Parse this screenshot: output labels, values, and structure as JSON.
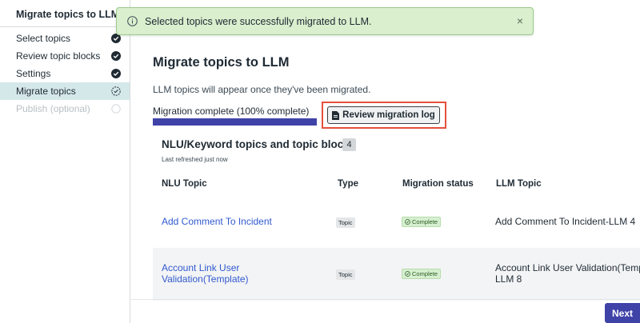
{
  "sidebar": {
    "title": "Migrate topics to LLM",
    "steps": [
      {
        "label": "Select topics"
      },
      {
        "label": "Review topic blocks"
      },
      {
        "label": "Settings"
      },
      {
        "label": "Migrate topics"
      },
      {
        "label": "Publish (optional)"
      }
    ]
  },
  "toast": {
    "message": "Selected topics were successfully migrated to LLM.",
    "close": "×"
  },
  "main": {
    "title": "Migrate topics to LLM",
    "subtitle": "LLM topics will appear once they've been migrated.",
    "progress_label": "Migration complete (100% complete)",
    "progress_fraction": 1.0,
    "review_button": "Review migration log",
    "section_title": "NLU/Keyword topics and topic blocks",
    "count": "4",
    "last_refreshed": "Last refreshed just now",
    "columns": [
      "NLU Topic",
      "Type",
      "Migration status",
      "LLM Topic"
    ],
    "rows": [
      {
        "nlu_topic": "Add Comment To Incident",
        "type": "Topic",
        "status": "Complete",
        "llm_topic": "Add Comment To Incident-LLM 4"
      },
      {
        "nlu_topic_line1": "Account Link User",
        "nlu_topic_line2": "Validation(Template)",
        "type": "Topic",
        "status": "Complete",
        "llm_topic_line1": "Account Link User Validation(Temp",
        "llm_topic_line2": "LLM 8"
      }
    ],
    "next_button": "Next"
  },
  "colors": {
    "accent": "#3f43a8",
    "highlight": "#e4503c",
    "success_bg": "#d9efce",
    "link": "#3159d0",
    "active_step_bg": "#d5e8e9"
  }
}
